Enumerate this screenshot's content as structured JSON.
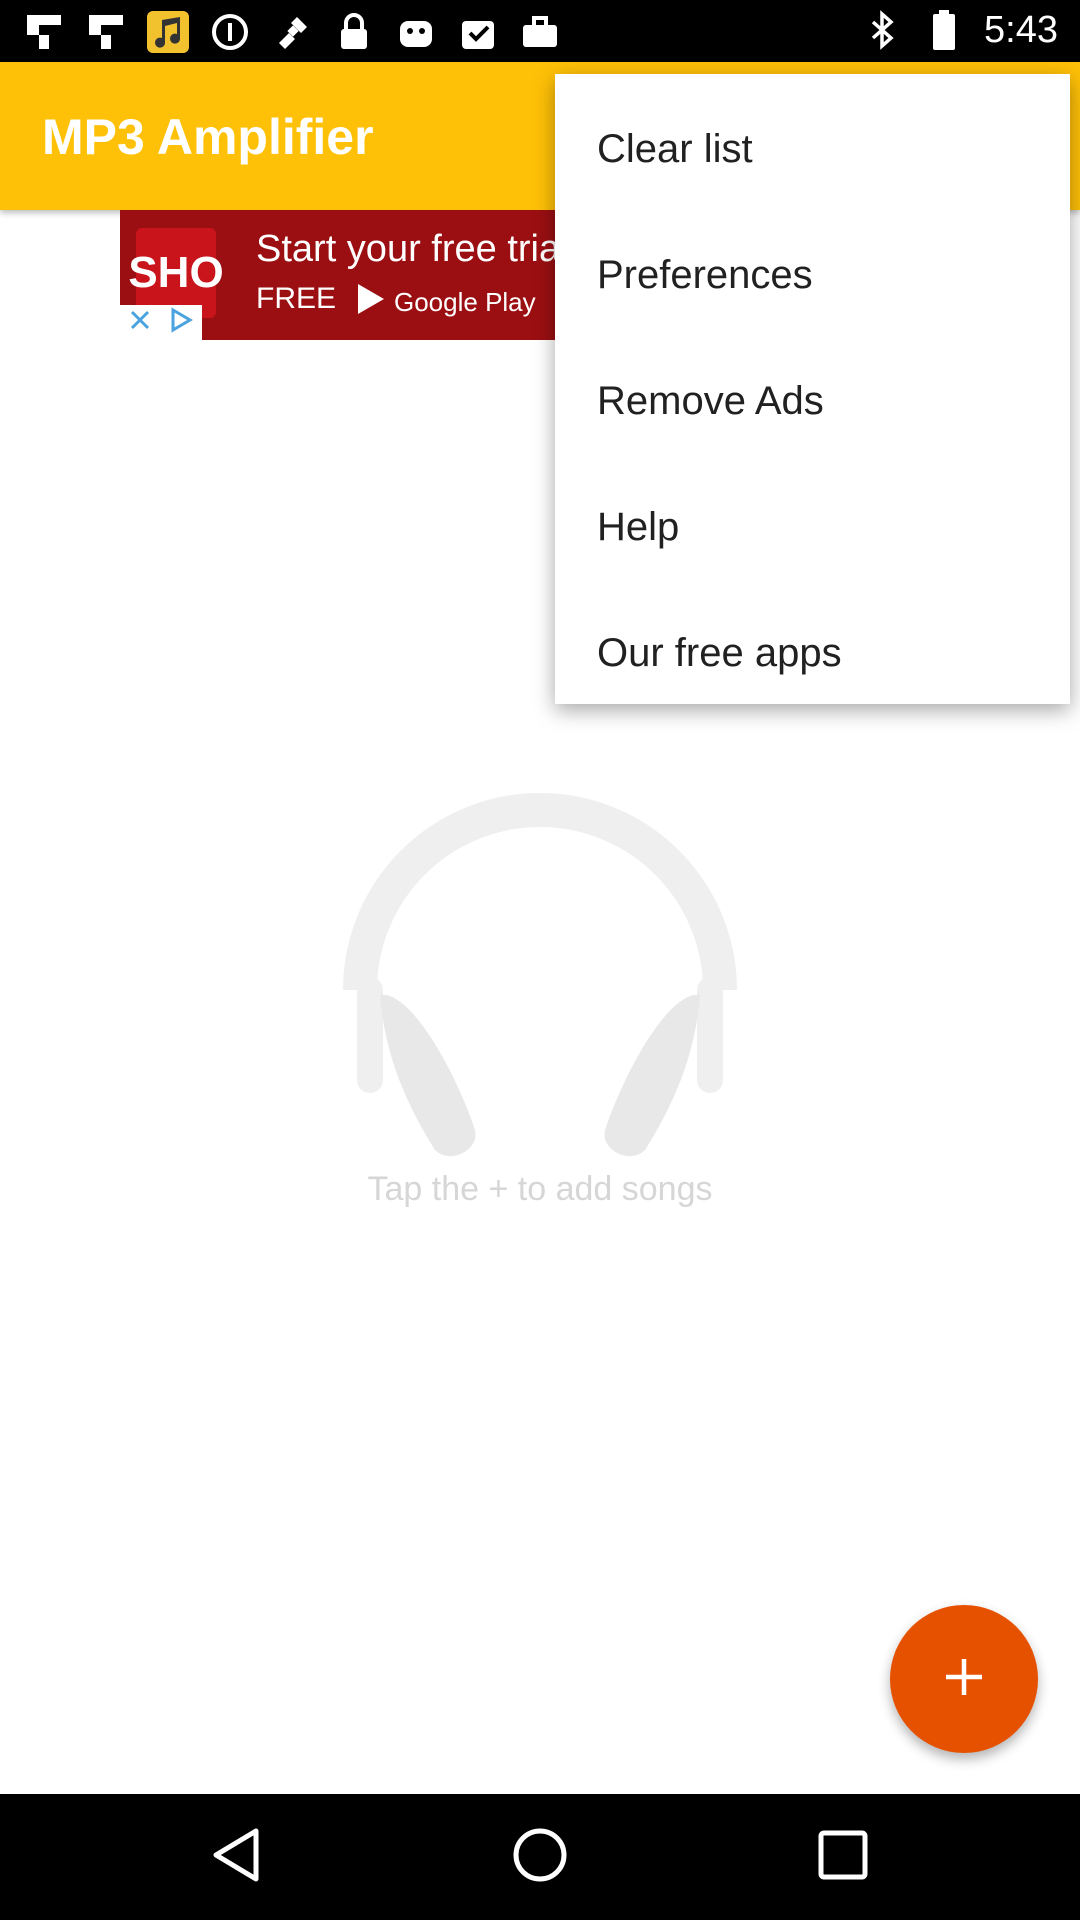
{
  "status_bar": {
    "time": "5:43",
    "icons": [
      "flipboard-icon",
      "flipboard-icon",
      "music-icon",
      "info-icon",
      "gps-icon",
      "lock-icon",
      "android-icon",
      "clipboard-check-icon",
      "briefcase-icon",
      "bluetooth-icon"
    ]
  },
  "app": {
    "title": "MP3 Amplifier",
    "accent_color": "#ffc107",
    "fab_color": "#e65100"
  },
  "ad": {
    "logo_text": "SHO",
    "line1": "Start your free trial",
    "line2": "FREE",
    "store_label": "Google Play"
  },
  "menu": {
    "items": [
      {
        "label": "Clear list"
      },
      {
        "label": "Preferences"
      },
      {
        "label": "Remove Ads"
      },
      {
        "label": "Help"
      },
      {
        "label": "Our free apps"
      }
    ]
  },
  "empty_state": {
    "message": "Tap the + to add songs"
  }
}
